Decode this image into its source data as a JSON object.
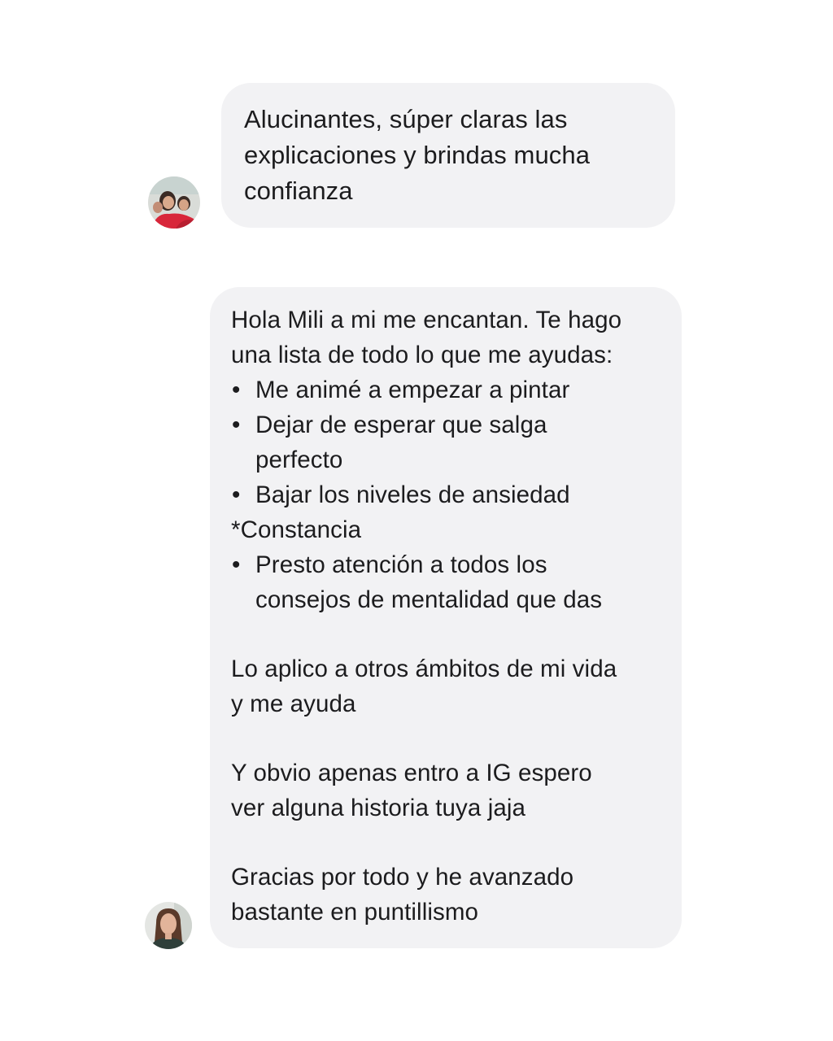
{
  "messages": [
    {
      "text_lines": [
        "Alucinantes, súper claras las",
        "explicaciones y brindas mucha",
        "confianza"
      ]
    },
    {
      "intro_lines": [
        "Hola Mili a mi me encantan. Te hago",
        "una lista de todo lo que me ayudas:"
      ],
      "bullet_symbol": "•",
      "bullets_a": [
        {
          "lines": [
            "Me animé a empezar a pintar"
          ]
        },
        {
          "lines": [
            "Dejar de esperar que salga",
            "perfecto"
          ]
        },
        {
          "lines": [
            "Bajar los niveles de ansiedad"
          ]
        }
      ],
      "plain_line": "*Constancia",
      "bullets_b": [
        {
          "lines": [
            "Presto atención a todos los",
            "consejos de mentalidad que das"
          ]
        }
      ],
      "paragraphs": [
        [
          "Lo aplico a otros ámbitos de mi vida",
          "y me ayuda"
        ],
        [
          "Y obvio apenas entro a IG espero",
          "ver alguna historia tuya jaja"
        ],
        [
          "Gracias por todo y he avanzado",
          "bastante en puntillismo"
        ]
      ]
    }
  ]
}
